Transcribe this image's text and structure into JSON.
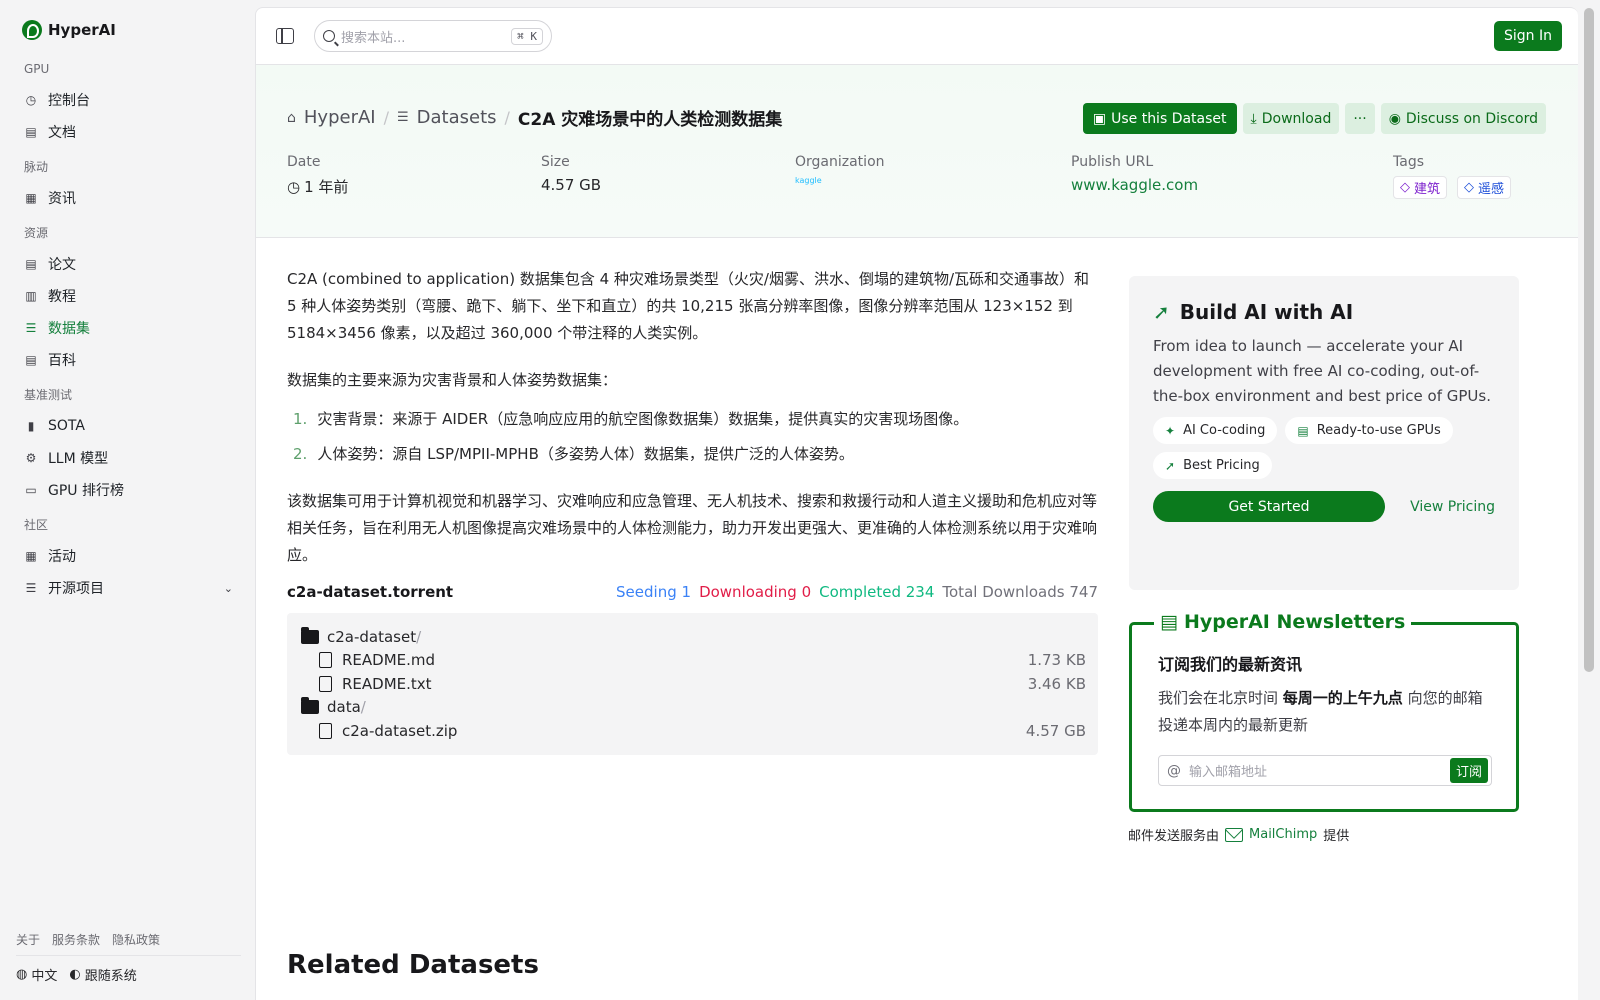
{
  "brand": {
    "name": "HyperAI"
  },
  "sidebar": {
    "sections": [
      {
        "title": "GPU",
        "items": [
          {
            "label": "控制台",
            "icon": "dashboard-icon"
          },
          {
            "label": "文档",
            "icon": "doc-icon"
          }
        ]
      },
      {
        "title": "脉动",
        "items": [
          {
            "label": "资讯",
            "icon": "news-icon"
          }
        ]
      },
      {
        "title": "资源",
        "items": [
          {
            "label": "论文",
            "icon": "paper-icon"
          },
          {
            "label": "教程",
            "icon": "book-icon"
          },
          {
            "label": "数据集",
            "icon": "database-icon",
            "active": true
          },
          {
            "label": "百科",
            "icon": "wiki-icon"
          }
        ]
      },
      {
        "title": "基准测试",
        "items": [
          {
            "label": "SOTA",
            "icon": "chart-icon"
          },
          {
            "label": "LLM 模型",
            "icon": "chip-icon"
          },
          {
            "label": "GPU 排行榜",
            "icon": "monitor-icon"
          }
        ]
      },
      {
        "title": "社区",
        "items": [
          {
            "label": "活动",
            "icon": "calendar-icon"
          },
          {
            "label": "开源项目",
            "icon": "list-icon",
            "expandable": true
          }
        ]
      }
    ],
    "footer_links": [
      "关于",
      "服务条款",
      "隐私政策"
    ],
    "language": "中文",
    "theme": "跟随系统"
  },
  "topbar": {
    "search_placeholder": "搜索本站...",
    "shortcut": "⌘ K",
    "sign_in": "Sign In"
  },
  "breadcrumb": {
    "home": "HyperAI",
    "section": "Datasets",
    "current": "C2A 灾难场景中的人类检测数据集"
  },
  "actions": {
    "use": "Use this Dataset",
    "download": "Download",
    "more": "···",
    "discord": "Discuss on Discord"
  },
  "meta": {
    "date_label": "Date",
    "date_value": "1 年前",
    "size_label": "Size",
    "size_value": "4.57 GB",
    "org_label": "Organization",
    "org_value": "kaggle",
    "url_label": "Publish URL",
    "url_value": "www.kaggle.com",
    "tags_label": "Tags",
    "tags": [
      "建筑",
      "遥感"
    ]
  },
  "body": {
    "p1": "C2A (combined to application) 数据集包含 4 种灾难场景类型（火灾/烟雾、洪水、倒塌的建筑物/瓦砾和交通事故）和 5 种人体姿势类别（弯腰、跪下、躺下、坐下和直立）的共 10,215 张高分辨率图像，图像分辨率范围从 123×152 到 5184×3456 像素，以及超过 360,000 个带注释的人类实例。",
    "p2": "数据集的主要来源为灾害背景和人体姿势数据集：",
    "list": [
      {
        "num": "1.",
        "text": "灾害背景：来源于 AIDER（应急响应应用的航空图像数据集）数据集，提供真实的灾害现场图像。"
      },
      {
        "num": "2.",
        "text": "人体姿势：源自 LSP/MPII-MPHB（多姿势人体）数据集，提供广泛的人体姿势。"
      }
    ],
    "p3": "该数据集可用于计算机视觉和机器学习、灾难响应和应急管理、无人机技术、搜索和救援行动和人道主义援助和危机应对等相关任务，旨在利用无人机图像提高灾难场景中的人体检测能力，助力开发出更强大、更准确的人体检测系统以用于灾难响应。"
  },
  "torrent": {
    "name": "c2a-dataset.torrent",
    "seeding_label": "Seeding",
    "seeding": "1",
    "downloading_label": "Downloading",
    "downloading": "0",
    "completed_label": "Completed",
    "completed": "234",
    "total_label": "Total Downloads",
    "total": "747",
    "folder1": "c2a-dataset",
    "file1_name": "README.md",
    "file1_size": "1.73 KB",
    "file2_name": "README.txt",
    "file2_size": "3.46 KB",
    "folder2": "data",
    "file3_name": "c2a-dataset.zip",
    "file3_size": "4.57 GB"
  },
  "build": {
    "title": "Build AI with AI",
    "desc": "From idea to launch — accelerate your AI development with free AI co-coding, out-of-the-box environment and best price of GPUs.",
    "chips": [
      "AI Co-coding",
      "Ready-to-use GPUs",
      "Best Pricing"
    ],
    "get_started": "Get Started",
    "view_pricing": "View Pricing"
  },
  "newsletter": {
    "title": "HyperAI Newsletters",
    "heading": "订阅我们的最新资讯",
    "desc_pre": "我们会在北京时间 ",
    "desc_bold": "每周一的上午九点",
    "desc_post": " 向您的邮箱投递本周内的最新更新",
    "email_placeholder": "输入邮箱地址",
    "subscribe": "订阅"
  },
  "mail_note": {
    "pre": "邮件发送服务由",
    "brand": "MailChimp",
    "post": "提供"
  },
  "related": {
    "title": "Related Datasets"
  },
  "colors": {
    "accent": "#0b7a1d",
    "link": "#15803d"
  }
}
